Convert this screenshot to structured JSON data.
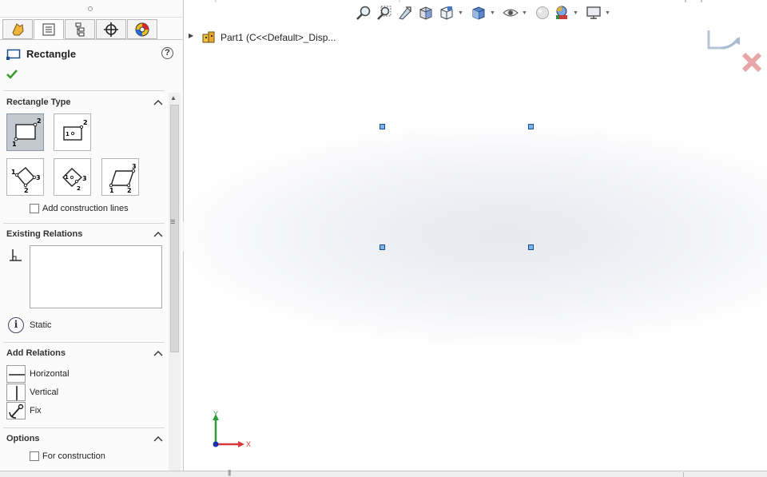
{
  "property_manager": {
    "title": "Rectangle",
    "help_label": "?",
    "tabs": [
      "feature-manager",
      "property-manager",
      "configuration-manager",
      "dimxpert-manager",
      "display-manager"
    ],
    "sections": {
      "rectangle_type": {
        "label": "Rectangle Type",
        "add_construction_lines": "Add construction lines"
      },
      "existing_relations": {
        "label": "Existing Relations",
        "status": "Static"
      },
      "add_relations": {
        "label": "Add Relations",
        "items": [
          "Horizontal",
          "Vertical",
          "Fix"
        ]
      },
      "options": {
        "label": "Options",
        "for_construction": "For construction"
      }
    }
  },
  "graphics": {
    "tree_label": "Part1  (C<<Default>_Disp...",
    "triad": {
      "y_label": "Y",
      "x_label": "X"
    }
  },
  "colors": {
    "accent_blue": "#1a4c8c",
    "handle_fill": "#7db2ee",
    "ok_green": "#3a9a2c",
    "cancel_red": "#e05555",
    "triad_green": "#2e9a3a",
    "triad_red": "#d83a3a"
  },
  "icons": [
    "search-icon",
    "zoom-area-icon",
    "previous-view-icon",
    "section-view-icon",
    "view-orientation-icon",
    "display-style-icon",
    "hide-show-icon",
    "appearance-icon",
    "scene-icon",
    "monitor-icon"
  ]
}
